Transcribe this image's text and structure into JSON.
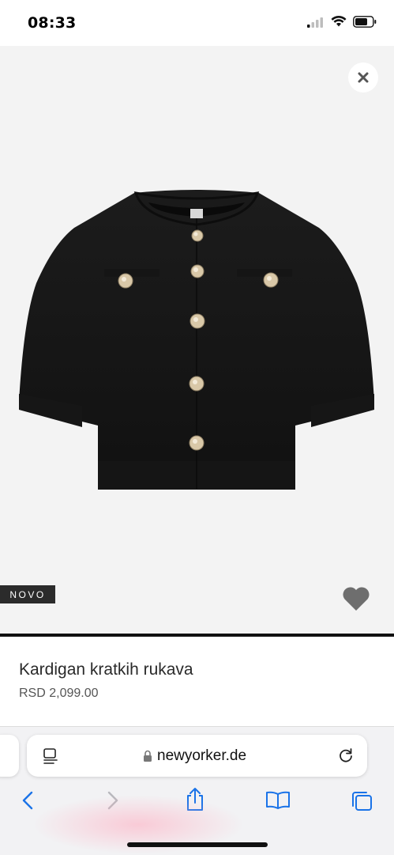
{
  "status": {
    "time": "08:33"
  },
  "product": {
    "badge": "NOVO",
    "title": "Kardigan kratkih rukava",
    "price": "RSD 2,099.00"
  },
  "browser": {
    "url": "newyorker.de"
  },
  "icons": {
    "close": "close-icon",
    "favorite": "heart-icon",
    "reader": "reader-icon",
    "lock": "lock-icon",
    "reload": "reload-icon",
    "back": "back-icon",
    "forward": "forward-icon",
    "share": "share-icon",
    "bookmarks": "book-icon",
    "tabs": "tabs-icon"
  },
  "colors": {
    "accent": "#1a73e8",
    "badge_bg": "#2b2b2b",
    "heart": "#6e6e6e"
  }
}
